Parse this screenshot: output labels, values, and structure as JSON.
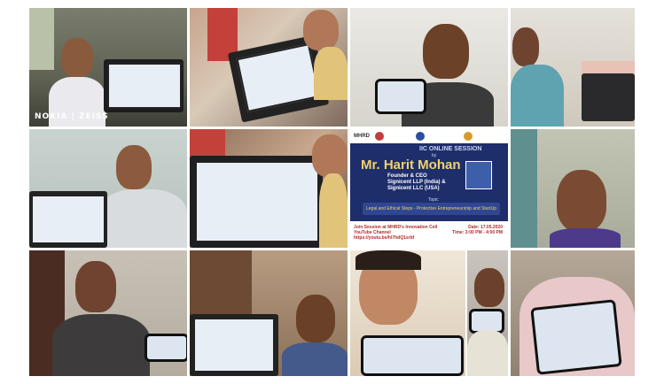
{
  "collage": {
    "watermark": "NOKIA | ZEISS"
  },
  "poster": {
    "logos": [
      "MHRD",
      "IIC",
      "Innovation Cell",
      "AICTE"
    ],
    "kicker": "IIC ONLINE SESSION",
    "by": "by",
    "speaker": "Mr. Harit Mohan",
    "role_line1": "Founder & CEO",
    "role_line2": "Signicent LLP (India) &",
    "role_line3": "Signicent LLC (USA)",
    "topic_label": "Topic",
    "topic": "Legal and Ethical Steps - Protective Entrepreneurship and StartUp",
    "live_line1": "Join Session at MHRD's Innovation Cell YouTube Channel",
    "live_line2": "https://youtu.be/hl7hdQ1srbf",
    "date_line1": "Date: 17.05.2020",
    "date_line2": "Time: 3:00 PM - 4:00 PM"
  },
  "colors": {
    "poster_panel": "#1e2e6b",
    "poster_accent": "#f1d36b",
    "poster_link": "#b32a2a"
  }
}
